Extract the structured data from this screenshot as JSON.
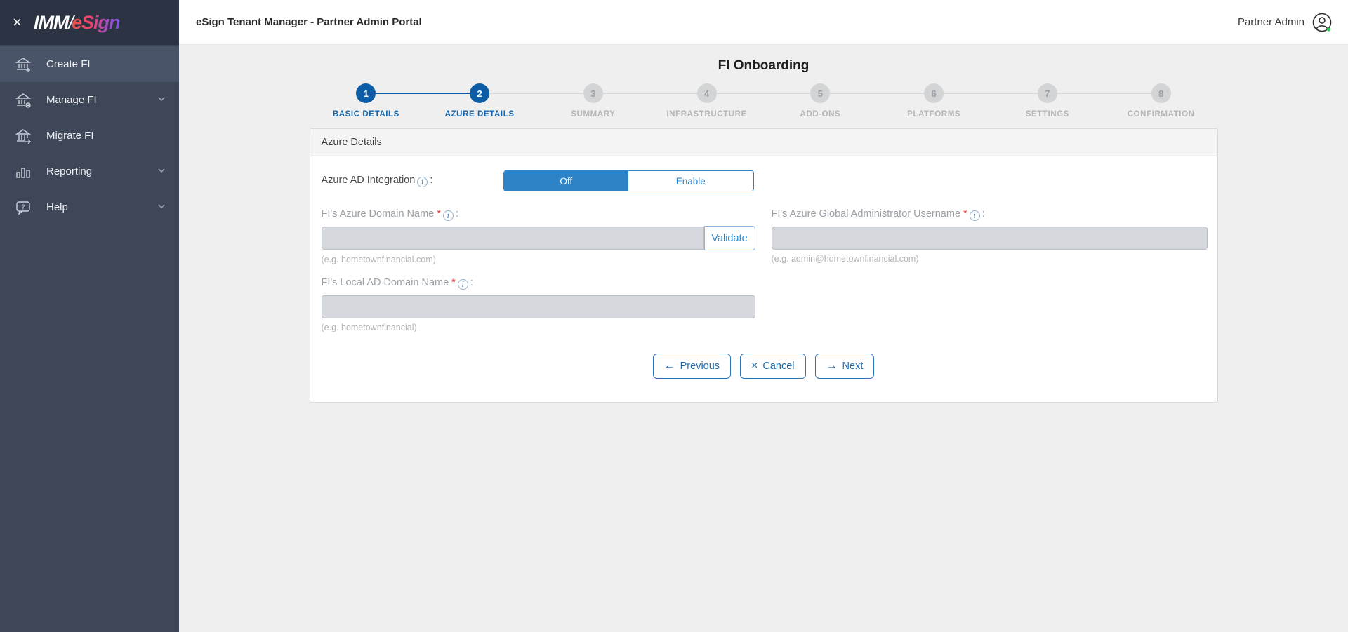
{
  "brand": {
    "imm": "IMM",
    "slash": "/",
    "esign": "eSign"
  },
  "header": {
    "title": "eSign Tenant Manager - Partner Admin Portal",
    "user": "Partner Admin"
  },
  "sidebar": {
    "close_glyph": "×",
    "items": [
      {
        "label": "Create FI"
      },
      {
        "label": "Manage FI"
      },
      {
        "label": "Migrate FI"
      },
      {
        "label": "Reporting"
      },
      {
        "label": "Help"
      }
    ]
  },
  "page": {
    "title": "FI Onboarding"
  },
  "stepper": {
    "steps": [
      {
        "number": "1",
        "label": "BASIC DETAILS",
        "state": "active"
      },
      {
        "number": "2",
        "label": "AZURE DETAILS",
        "state": "active"
      },
      {
        "number": "3",
        "label": "SUMMARY",
        "state": "upcoming"
      },
      {
        "number": "4",
        "label": "INFRASTRUCTURE",
        "state": "upcoming"
      },
      {
        "number": "5",
        "label": "ADD-ONS",
        "state": "upcoming"
      },
      {
        "number": "6",
        "label": "PLATFORMS",
        "state": "upcoming"
      },
      {
        "number": "7",
        "label": "SETTINGS",
        "state": "upcoming"
      },
      {
        "number": "8",
        "label": "CONFIRMATION",
        "state": "upcoming"
      }
    ]
  },
  "panel": {
    "title": "Azure Details",
    "toggle": {
      "label": "Azure AD Integration",
      "off_label": "Off",
      "enable_label": "Enable",
      "selected": "Off"
    },
    "fields": [
      {
        "label": "FI's Azure Domain Name",
        "value": "",
        "hint": "(e.g. hometownfinancial.com)",
        "button": "Validate"
      },
      {
        "label": "FI's Azure Global Administrator Username",
        "value": "",
        "hint": "(e.g. admin@hometownfinancial.com)"
      },
      {
        "label": "FI's Local AD Domain Name",
        "value": "",
        "hint": "(e.g. hometownfinancial)"
      }
    ],
    "buttons": {
      "previous": "Previous",
      "cancel": "Cancel",
      "next": "Next",
      "previous_glyph": "←",
      "cancel_glyph": "×",
      "next_glyph": "→"
    }
  },
  "ui": {
    "required_mark": "*",
    "colon": ":",
    "info_glyph": "i"
  },
  "colors": {
    "accent_blue": "#0d5da6",
    "toggle_blue": "#2e83c6",
    "sidebar_bg": "#3e4757",
    "sidebar_top": "#2c3443",
    "content_bg": "#efefef",
    "status_green": "#35c759"
  }
}
